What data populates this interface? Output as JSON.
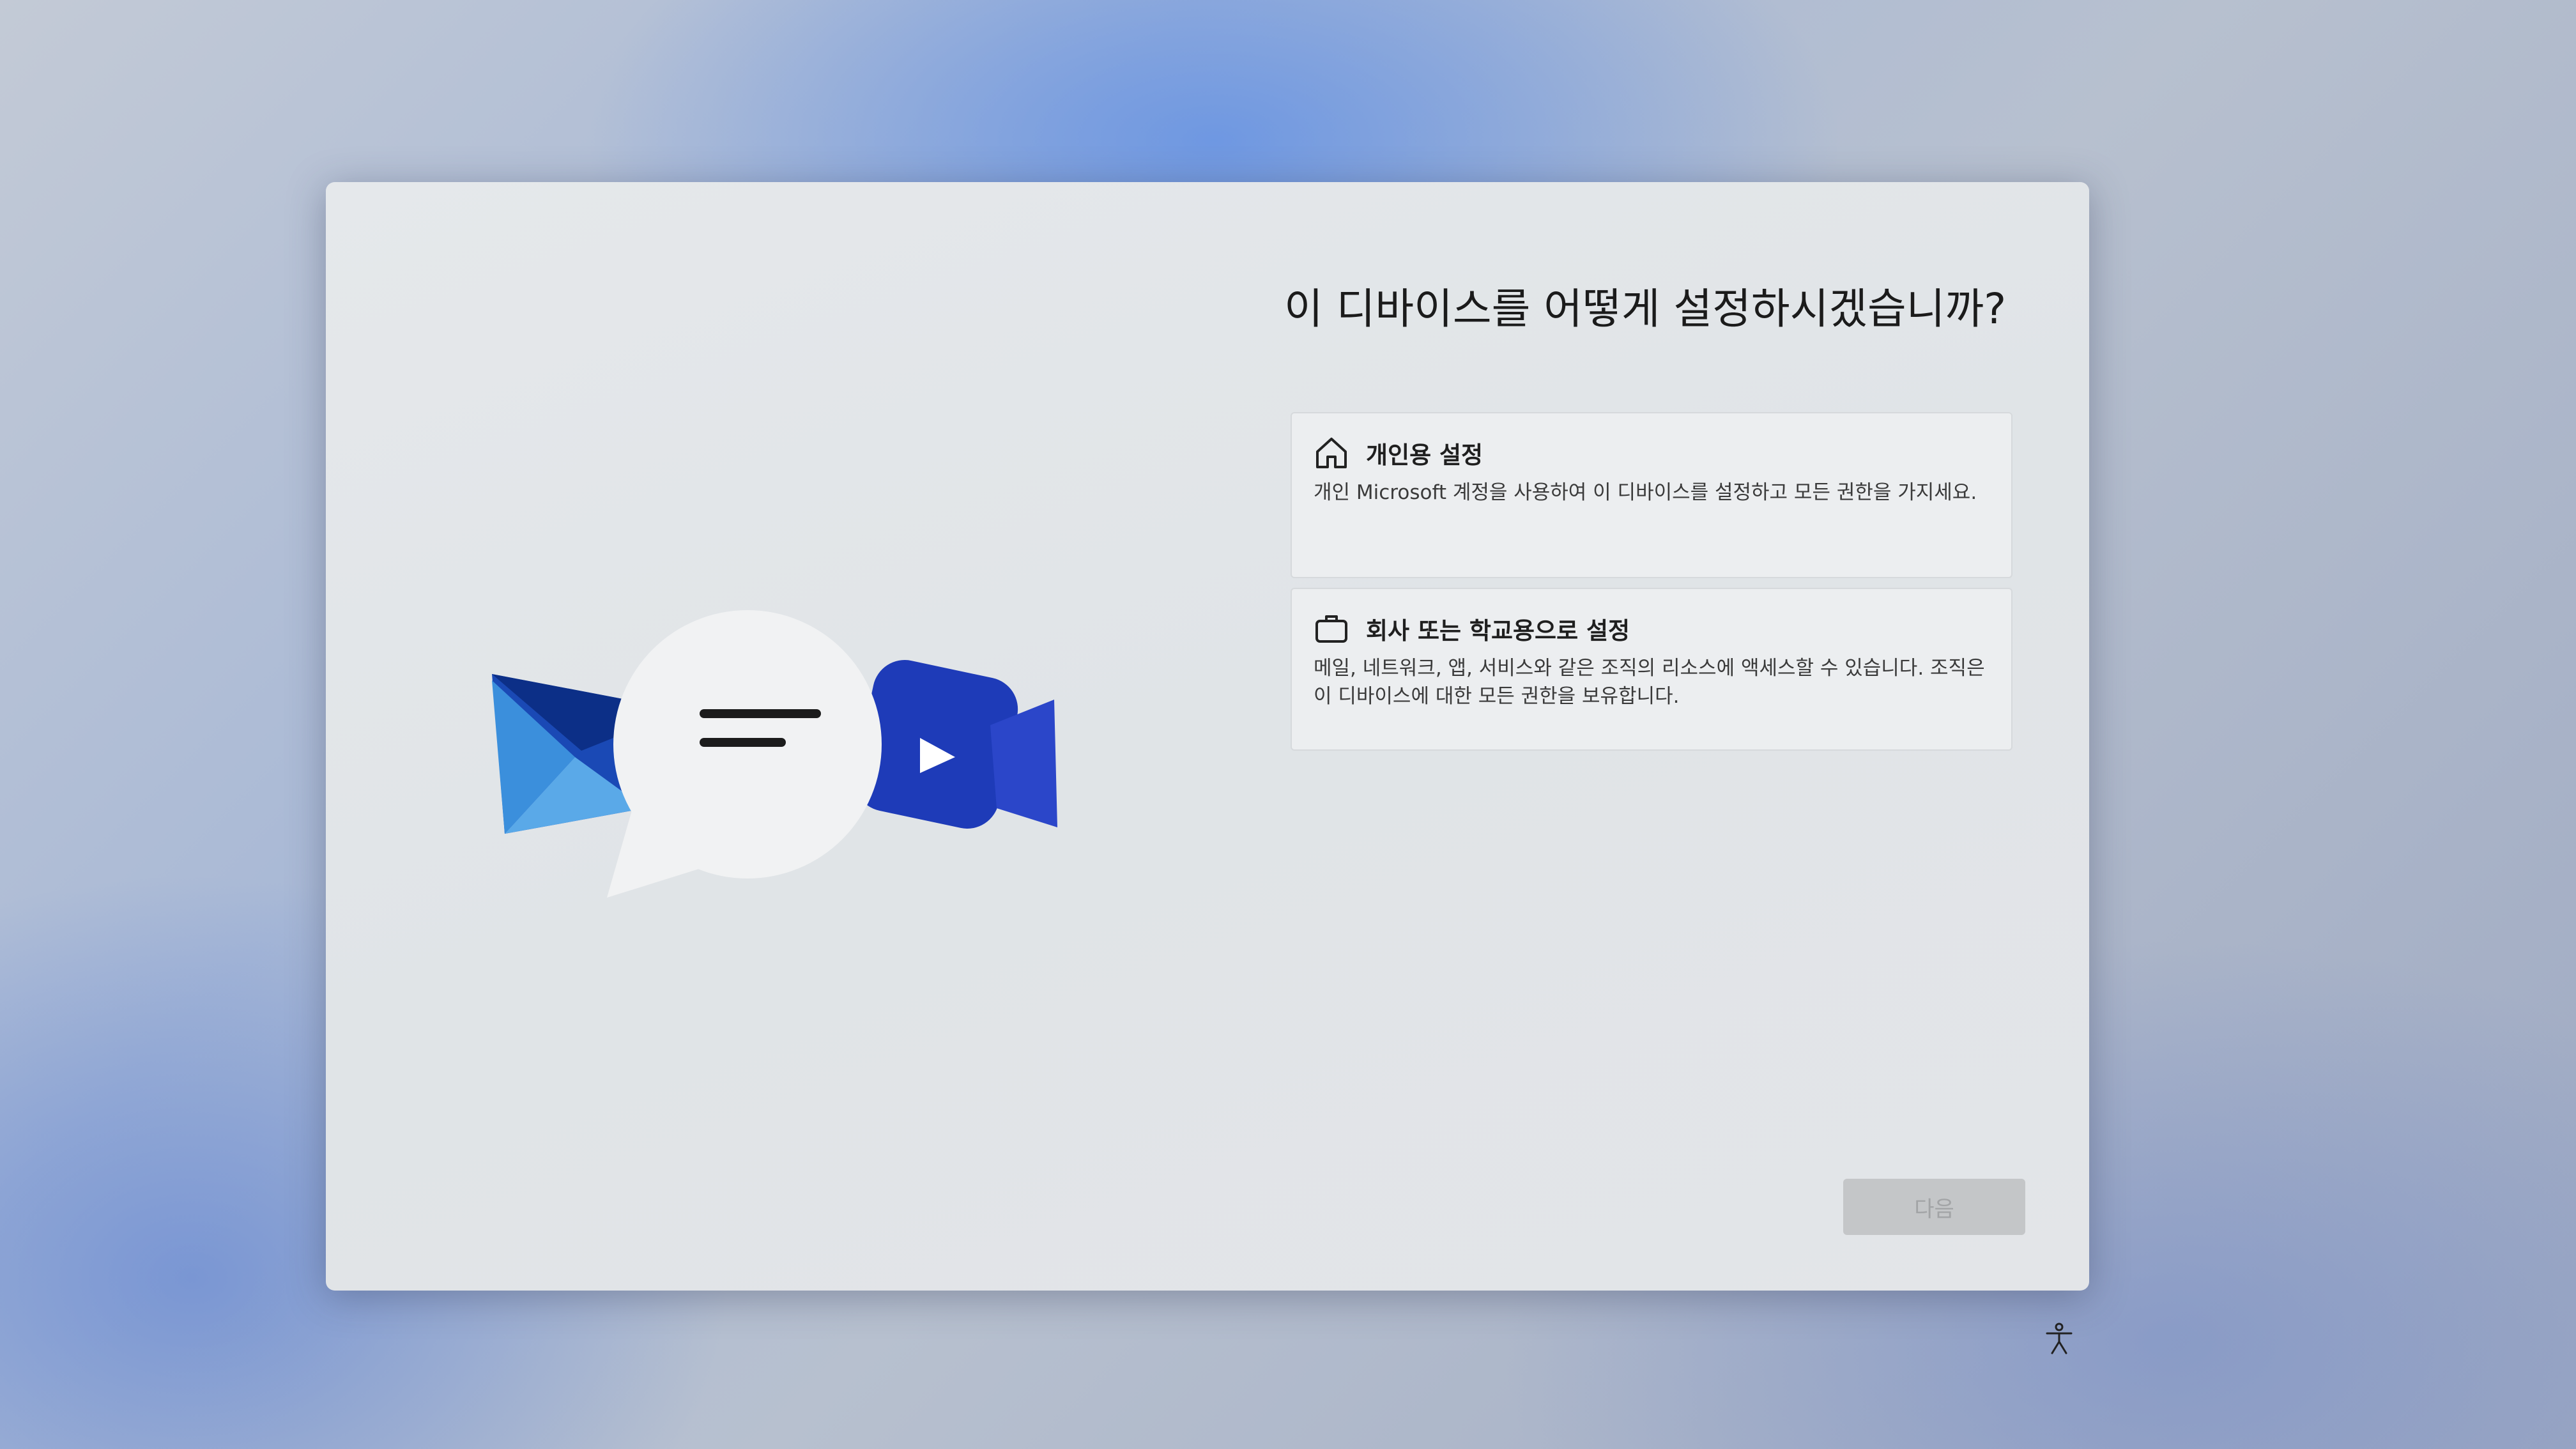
{
  "setup": {
    "title": "이 디바이스를 어떻게 설정하시겠습니까?",
    "options": [
      {
        "icon": "home-icon",
        "title": "개인용 설정",
        "description": "개인 Microsoft 계정을 사용하여 이 디바이스를 설정하고 모든 권한을 가지세요."
      },
      {
        "icon": "briefcase-icon",
        "title": "회사 또는 학교용으로 설정",
        "description": "메일, 네트워크, 앱, 서비스와 같은 조직의 리소스에 액세스할 수 있습니다. 조직은 이 디바이스에 대한 모든 권한을 보유합니다."
      }
    ],
    "next_label": "다음"
  },
  "illustration": {
    "mail_icon": "mail-icon",
    "chat_icon": "chat-bubble-icon",
    "video_icon": "video-camera-icon"
  },
  "taskbar": {
    "accessibility_icon": "accessibility-icon"
  },
  "colors": {
    "accent_dark": "#0f2f8f",
    "accent_blue": "#2a6fd0",
    "video_blue": "#1e3bb8"
  }
}
